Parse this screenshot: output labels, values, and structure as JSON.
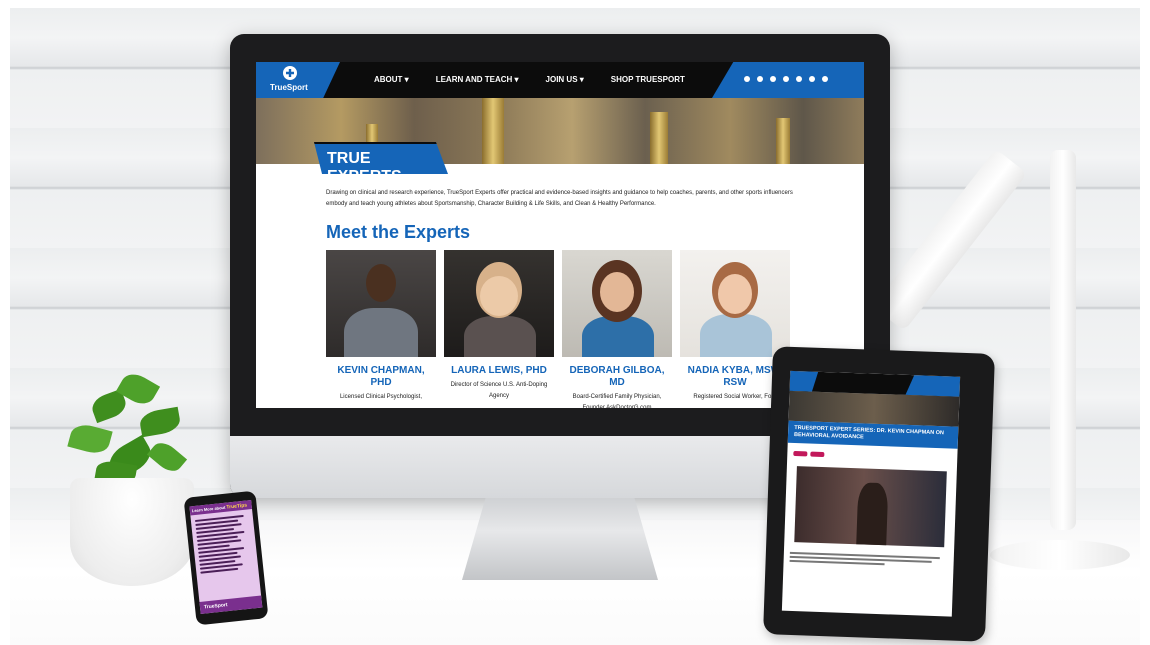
{
  "brand": {
    "logo_text": "TrueSport",
    "accent": "#1565b8",
    "nav_bg": "#0c0c0c"
  },
  "nav": {
    "items": [
      {
        "label": "ABOUT ▾"
      },
      {
        "label": "LEARN AND TEACH ▾"
      },
      {
        "label": "JOIN US ▾"
      },
      {
        "label": "SHOP TRUESPORT"
      }
    ],
    "social_icons": [
      "search-icon",
      "facebook-icon",
      "twitter-icon",
      "youtube-icon",
      "instagram-icon",
      "linkedin-icon",
      "pinterest-icon"
    ]
  },
  "banner": {
    "title": "TRUE EXPERTS"
  },
  "intro": "Drawing on clinical and research experience, TrueSport Experts offer practical and evidence-based insights and guidance to help coaches, parents, and other sports influencers embody and teach young athletes about Sportsmanship, Character Building & Life Skills, and Clean & Healthy Performance.",
  "section_title": "Meet the Experts",
  "experts": [
    {
      "name": "KEVIN CHAPMAN, PHD",
      "role": "Licensed Clinical Psychologist,"
    },
    {
      "name": "LAURA LEWIS, PHD",
      "role": "Director of Science U.S. Anti-Doping Agency"
    },
    {
      "name": "DEBORAH GILBOA, MD",
      "role": "Board-Certified Family Physician, Founder AskDoctorG.com"
    },
    {
      "name": "NADIA KYBA, MSW, RSW",
      "role": "Registered Social Worker, Four"
    }
  ],
  "tablet": {
    "article_title": "TRUESPORT EXPERT SERIES: DR. KEVIN CHAPMAN ON BEHAVIORAL AVOIDANCE"
  },
  "phone": {
    "header_prefix": "Learn More about",
    "header_brand": "TrueTips",
    "footer_brand": "TrueSport"
  }
}
